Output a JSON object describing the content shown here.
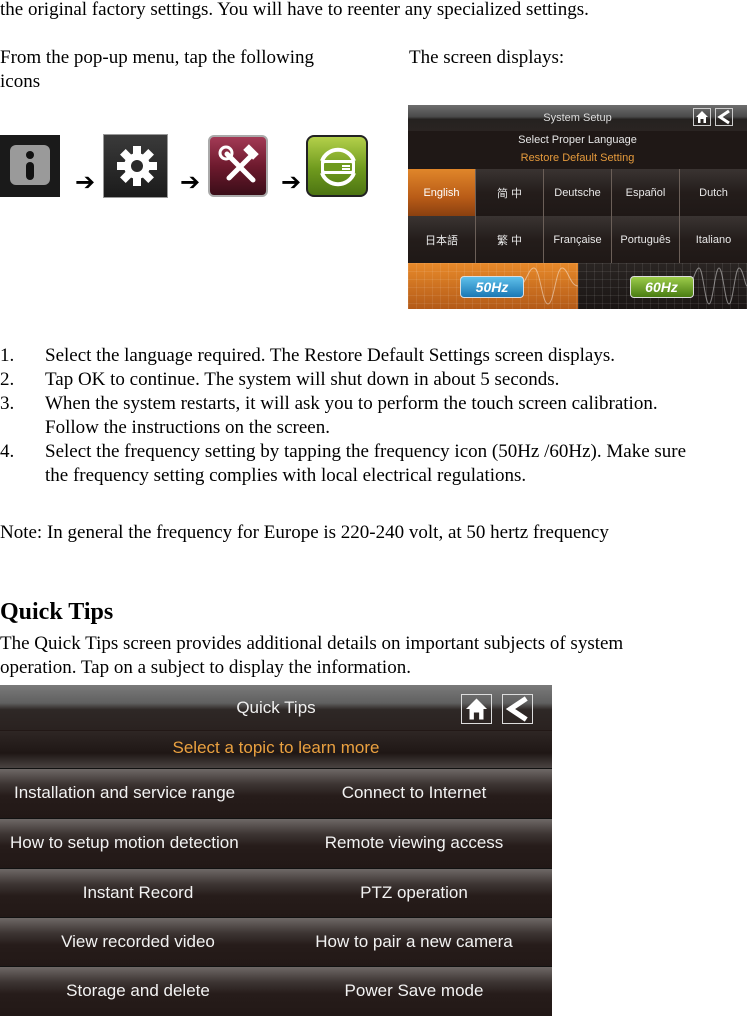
{
  "doc": {
    "intro_line": "the original factory settings. You will have to reenter any specialized settings.",
    "popup_instruction": "From the pop-up menu, tap the following",
    "popup_instruction_cont": "icons",
    "screen_displays": "The screen displays:",
    "icon_sequence": [
      {
        "name": "info-icon"
      },
      {
        "name": "gear-icon"
      },
      {
        "name": "tools-icon"
      },
      {
        "name": "restore-icon"
      }
    ],
    "arrow": "➔",
    "steps": [
      {
        "num": "1.",
        "text": "Select the language required. The Restore Default Settings screen displays."
      },
      {
        "num": "2.",
        "text": "Tap OK to continue. The system will shut down in about 5 seconds."
      },
      {
        "num": "3.",
        "text": "When the system restarts, it will ask you to perform the touch screen calibration.",
        "cont": "Follow the instructions on the screen."
      },
      {
        "num": "4.",
        "text": "Select the frequency setting by tapping the frequency icon (50Hz /60Hz). Make sure",
        "cont": "the frequency setting complies with local electrical regulations."
      }
    ],
    "note": "Note: In general the frequency for Europe is 220-240 volt, at 50 hertz frequency",
    "quick_tips_heading": "Quick Tips",
    "quick_tips_desc_1": "The Quick Tips screen provides additional details on important subjects of system",
    "quick_tips_desc_2": "operation. Tap on a subject to display the information."
  },
  "system_setup": {
    "title": "System Setup",
    "subtitle": "Select Proper Language",
    "subtitle2": "Restore Default Setting",
    "languages_row1": [
      "English",
      "简 中",
      "Deutsche",
      "Español",
      "Dutch"
    ],
    "languages_row2": [
      "日本語",
      "繁 中",
      "Française",
      "Português",
      "Italiano"
    ],
    "selected_language": "English",
    "freq_50": "50Hz",
    "freq_60": "60Hz",
    "selected_freq": "50Hz",
    "accent": "#e59a3c"
  },
  "quick_tips_screen": {
    "title": "Quick Tips",
    "subtitle": "Select a topic to learn more",
    "rows": [
      [
        "Installation and service range",
        "Connect to Internet"
      ],
      [
        "How to setup motion detection",
        "Remote viewing access"
      ],
      [
        "Instant Record",
        "PTZ operation"
      ],
      [
        "View recorded video",
        "How to pair a new camera"
      ],
      [
        "Storage and delete",
        "Power Save mode"
      ]
    ],
    "accent": "#eaa140"
  }
}
